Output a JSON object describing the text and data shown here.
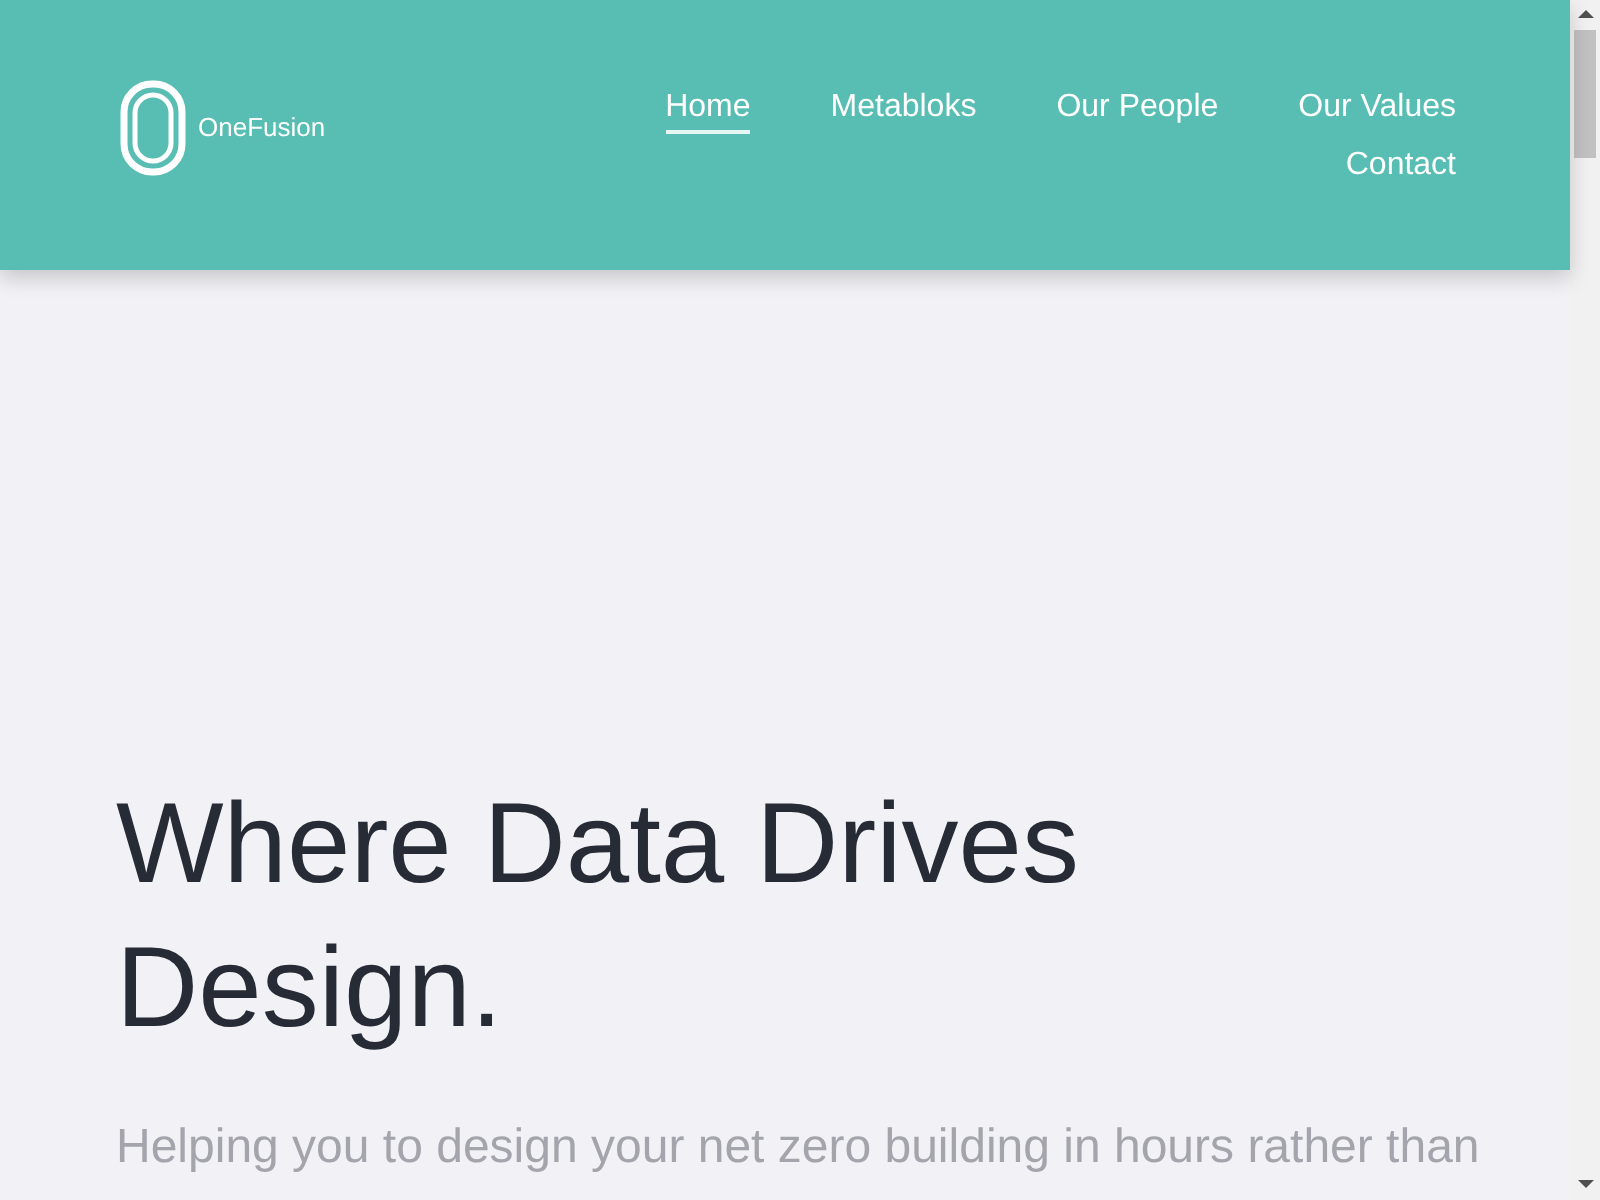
{
  "header": {
    "logo": {
      "text": "OneFusion"
    },
    "nav": [
      {
        "label": "Home",
        "selected": true
      },
      {
        "label": "Metabloks",
        "selected": false
      },
      {
        "label": "Our People",
        "selected": false
      },
      {
        "label": "Our Values",
        "selected": false
      },
      {
        "label": "Contact",
        "selected": false
      }
    ]
  },
  "hero": {
    "heading": "Where Data Drives Design.",
    "subheading": "Helping you to design your net zero building in hours rather than"
  }
}
